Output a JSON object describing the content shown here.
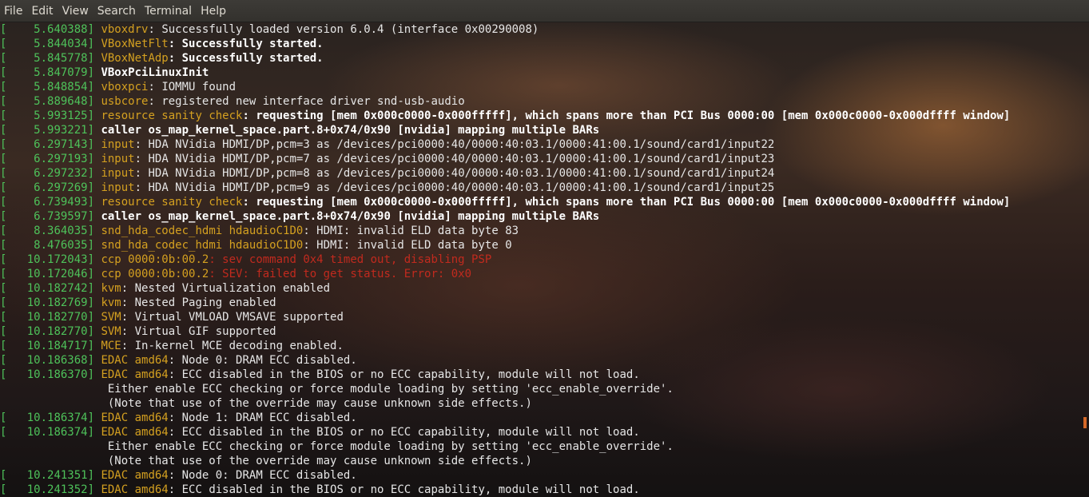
{
  "menu": [
    "File",
    "Edit",
    "View",
    "Search",
    "Terminal",
    "Help"
  ],
  "colors": {
    "timestamp": "#4ec25a",
    "subsystem": "#d4a020",
    "error": "#c12a1e",
    "text": "#e6e6e6",
    "bold": "#ffffff"
  },
  "lines": [
    {
      "ts": "    5.640388",
      "sub": "vboxdrv",
      "msg": ": Successfully loaded version 6.0.4 (interface 0x00290008)",
      "style": "normal"
    },
    {
      "ts": "    5.844034",
      "sub": "VBoxNetFlt",
      "msg": ": Successfully started.",
      "style": "boldmsg"
    },
    {
      "ts": "    5.845778",
      "sub": "VBoxNetAdp",
      "msg": ": Successfully started.",
      "style": "boldmsg"
    },
    {
      "ts": "    5.847079",
      "sub": "",
      "msg": "VBoxPciLinuxInit",
      "style": "bold"
    },
    {
      "ts": "    5.848854",
      "sub": "vboxpci",
      "msg": ": IOMMU found",
      "style": "normal"
    },
    {
      "ts": "    5.889648",
      "sub": "usbcore",
      "msg": ": registered new interface driver snd-usb-audio",
      "style": "normal"
    },
    {
      "ts": "    5.993125",
      "sub": "resource sanity check",
      "msg": ": requesting [mem 0x000c0000-0x000fffff], which spans more than PCI Bus 0000:00 [mem 0x000c0000-0x000dffff window]",
      "style": "boldmsg"
    },
    {
      "ts": "    5.993221",
      "sub": "",
      "msg": "caller os_map_kernel_space.part.8+0x74/0x90 [nvidia] mapping multiple BARs",
      "style": "bold"
    },
    {
      "ts": "    6.297143",
      "sub": "input",
      "msg": ": HDA NVidia HDMI/DP,pcm=3 as /devices/pci0000:40/0000:40:03.1/0000:41:00.1/sound/card1/input22",
      "style": "normal"
    },
    {
      "ts": "    6.297193",
      "sub": "input",
      "msg": ": HDA NVidia HDMI/DP,pcm=7 as /devices/pci0000:40/0000:40:03.1/0000:41:00.1/sound/card1/input23",
      "style": "normal"
    },
    {
      "ts": "    6.297232",
      "sub": "input",
      "msg": ": HDA NVidia HDMI/DP,pcm=8 as /devices/pci0000:40/0000:40:03.1/0000:41:00.1/sound/card1/input24",
      "style": "normal"
    },
    {
      "ts": "    6.297269",
      "sub": "input",
      "msg": ": HDA NVidia HDMI/DP,pcm=9 as /devices/pci0000:40/0000:40:03.1/0000:41:00.1/sound/card1/input25",
      "style": "normal"
    },
    {
      "ts": "    6.739493",
      "sub": "resource sanity check",
      "msg": ": requesting [mem 0x000c0000-0x000fffff], which spans more than PCI Bus 0000:00 [mem 0x000c0000-0x000dffff window]",
      "style": "boldmsg"
    },
    {
      "ts": "    6.739597",
      "sub": "",
      "msg": "caller os_map_kernel_space.part.8+0x74/0x90 [nvidia] mapping multiple BARs",
      "style": "bold"
    },
    {
      "ts": "    8.364035",
      "sub": "snd_hda_codec_hdmi hdaudioC1D0",
      "msg": ": HDMI: invalid ELD data byte 83",
      "style": "normal"
    },
    {
      "ts": "    8.476035",
      "sub": "snd_hda_codec_hdmi hdaudioC1D0",
      "msg": ": HDMI: invalid ELD data byte 0",
      "style": "normal"
    },
    {
      "ts": "   10.172043",
      "sub": "ccp 0000:0b:00.2",
      "msg": ": sev command 0x4 timed out, disabling PSP",
      "style": "error"
    },
    {
      "ts": "   10.172046",
      "sub": "ccp 0000:0b:00.2",
      "msg": ": SEV: failed to get status. Error: 0x0",
      "style": "error"
    },
    {
      "ts": "   10.182742",
      "sub": "kvm",
      "msg": ": Nested Virtualization enabled",
      "style": "normal"
    },
    {
      "ts": "   10.182769",
      "sub": "kvm",
      "msg": ": Nested Paging enabled",
      "style": "normal"
    },
    {
      "ts": "   10.182770",
      "sub": "SVM",
      "msg": ": Virtual VMLOAD VMSAVE supported",
      "style": "normal"
    },
    {
      "ts": "   10.182770",
      "sub": "SVM",
      "msg": ": Virtual GIF supported",
      "style": "normal"
    },
    {
      "ts": "   10.184717",
      "sub": "MCE",
      "msg": ": In-kernel MCE decoding enabled.",
      "style": "normal"
    },
    {
      "ts": "   10.186368",
      "sub": "EDAC amd64",
      "msg": ": Node 0: DRAM ECC disabled.",
      "style": "normal"
    },
    {
      "ts": "   10.186370",
      "sub": "EDAC amd64",
      "msg": ": ECC disabled in the BIOS or no ECC capability, module will not load.",
      "style": "normal"
    },
    {
      "ts": "",
      "sub": "",
      "msg": "                Either enable ECC checking or force module loading by setting 'ecc_enable_override'.",
      "style": "cont"
    },
    {
      "ts": "",
      "sub": "",
      "msg": "                (Note that use of the override may cause unknown side effects.)",
      "style": "cont"
    },
    {
      "ts": "   10.186374",
      "sub": "EDAC amd64",
      "msg": ": Node 1: DRAM ECC disabled.",
      "style": "normal"
    },
    {
      "ts": "   10.186374",
      "sub": "EDAC amd64",
      "msg": ": ECC disabled in the BIOS or no ECC capability, module will not load.",
      "style": "normal"
    },
    {
      "ts": "",
      "sub": "",
      "msg": "                Either enable ECC checking or force module loading by setting 'ecc_enable_override'.",
      "style": "cont"
    },
    {
      "ts": "",
      "sub": "",
      "msg": "                (Note that use of the override may cause unknown side effects.)",
      "style": "cont"
    },
    {
      "ts": "   10.241351",
      "sub": "EDAC amd64",
      "msg": ": Node 0: DRAM ECC disabled.",
      "style": "normal"
    },
    {
      "ts": "   10.241352",
      "sub": "EDAC amd64",
      "msg": ": ECC disabled in the BIOS or no ECC capability, module will not load.",
      "style": "normal"
    }
  ]
}
